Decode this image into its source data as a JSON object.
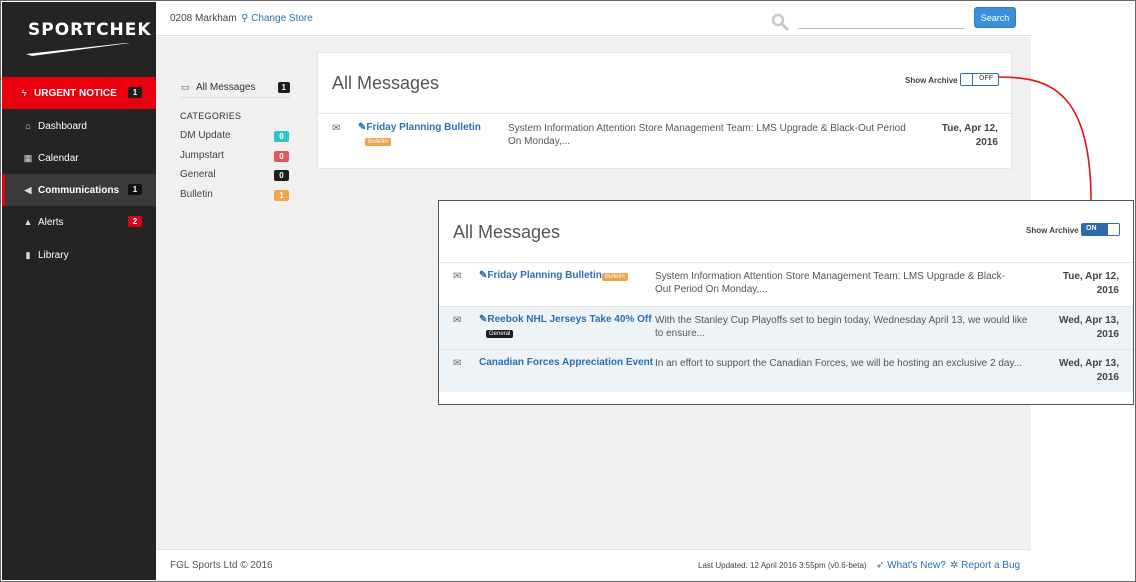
{
  "brand": {
    "logo_text": "SportChek"
  },
  "sidebar": {
    "items": [
      {
        "label": "URGENT NOTICE",
        "count": "1",
        "icon": "bolt-icon"
      },
      {
        "label": "Dashboard",
        "icon": "home-icon"
      },
      {
        "label": "Calendar",
        "icon": "calendar-icon"
      },
      {
        "label": "Communications",
        "count": "1",
        "icon": "megaphone-icon"
      },
      {
        "label": "Alerts",
        "count": "2",
        "icon": "bell-icon"
      },
      {
        "label": "Library",
        "icon": "book-icon"
      }
    ]
  },
  "topbar": {
    "store": "0208 Markham",
    "change_store": "Change Store",
    "search_placeholder": "",
    "search_button": "Search"
  },
  "filters": {
    "all_messages": {
      "label": "All Messages",
      "count": "1"
    },
    "categories_heading": "CATEGORIES",
    "categories": [
      {
        "label": "DM Update",
        "count": "0",
        "color": "#2ec4c4"
      },
      {
        "label": "Jumpstart",
        "count": "0",
        "color": "#e2555d"
      },
      {
        "label": "General",
        "count": "0",
        "color": "#1e1e1e"
      },
      {
        "label": "Bulletin",
        "count": "1",
        "color": "#f1a34c"
      }
    ]
  },
  "panel_small": {
    "title": "All Messages",
    "archive_label": "Show Archive",
    "toggle_state": "OFF",
    "messages": [
      {
        "title": "Friday Planning Bulletin",
        "badge": "Bulletin",
        "summary": "System Information Attention Store Management Team: LMS Upgrade & Black-Out Period On Monday,...",
        "date_line1": "Tue, Apr 12,",
        "date_line2": "2016"
      }
    ]
  },
  "panel_big": {
    "title": "All Messages",
    "archive_label": "Show Archive",
    "toggle_state": "ON",
    "messages": [
      {
        "title": "Friday Planning Bulletin",
        "badge": "Bulletin",
        "summary": "System Information Attention Store Management Team: LMS Upgrade & Black-Out Period On Monday,...",
        "date_line1": "Tue, Apr 12,",
        "date_line2": "2016"
      },
      {
        "title": "Reebok NHL Jerseys Take 40% Off",
        "badge": "General",
        "summary": "With the Stanley Cup Playoffs set to begin today, Wednesday April 13, we would like to ensure...",
        "date_line1": "Wed, Apr 13,",
        "date_line2": "2016"
      },
      {
        "title": "Canadian Forces Appreciation Event",
        "summary": "In an effort to support the Canadian Forces, we will be hosting an exclusive 2 day...",
        "date_line1": "Wed, Apr 13,",
        "date_line2": "2016"
      }
    ]
  },
  "footer": {
    "copyright": "FGL Sports Ltd © 2016",
    "last_updated": "Last Updated: 12 April 2016 3:55pm (v0.6-beta)",
    "whats_new": "What's New?",
    "report_bug": "Report a Bug"
  },
  "colors": {
    "accent": "#e8000c",
    "link": "#2b6fb3",
    "sidebar_bg": "#242424",
    "primary_button": "#3b8fd9"
  }
}
